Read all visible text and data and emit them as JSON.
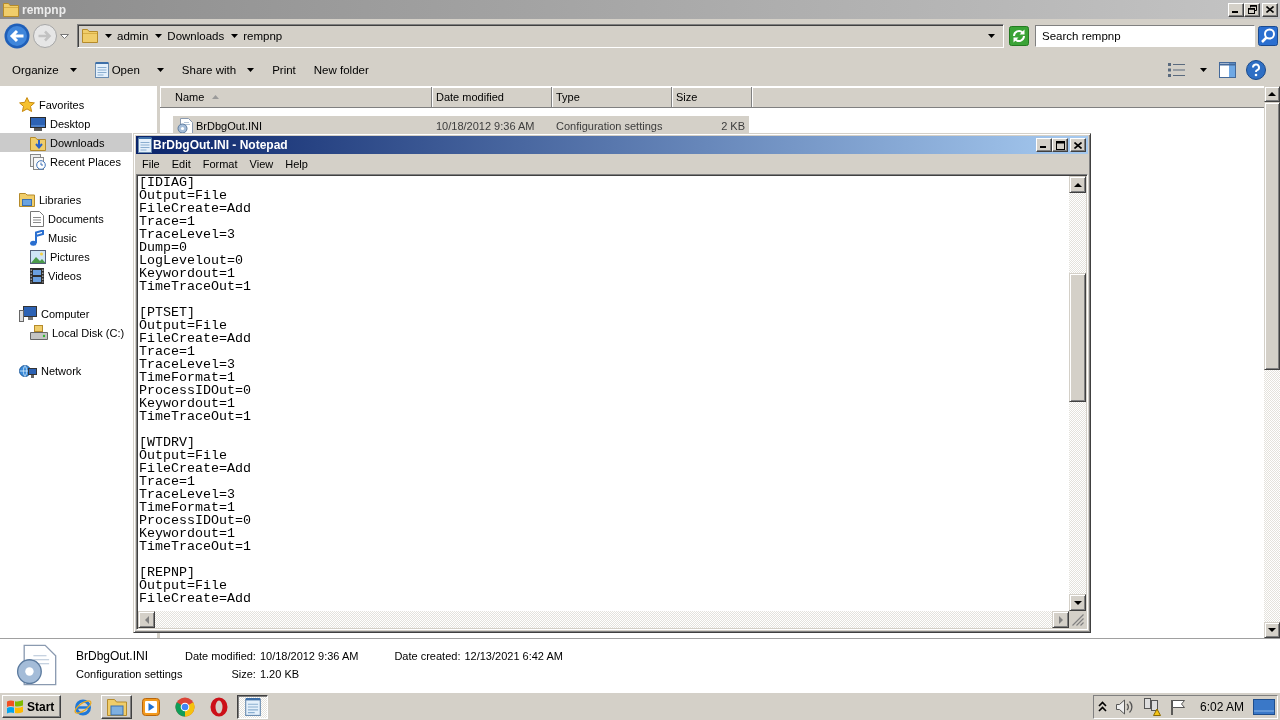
{
  "explorer": {
    "title": "rempnp",
    "active": false,
    "maximized": true,
    "breadcrumb": [
      "admin",
      "Downloads",
      "rempnp"
    ],
    "search": {
      "placeholder": "Search rempnp"
    },
    "toolbar": [
      {
        "label": "Organize",
        "kind": "menu"
      },
      {
        "label": "Open",
        "kind": "split"
      },
      {
        "label": "Share with",
        "kind": "menu"
      },
      {
        "label": "Print",
        "kind": "command"
      },
      {
        "label": "New folder",
        "kind": "command"
      }
    ],
    "sidebar": [
      {
        "label": "Favorites",
        "selected": false,
        "children": [
          {
            "label": "Desktop",
            "selected": false
          },
          {
            "label": "Downloads",
            "selected": true
          },
          {
            "label": "Recent Places",
            "selected": false
          }
        ]
      },
      {
        "label": "Libraries",
        "selected": false,
        "children": [
          {
            "label": "Documents",
            "selected": false
          },
          {
            "label": "Music",
            "selected": false
          },
          {
            "label": "Pictures",
            "selected": false
          },
          {
            "label": "Videos",
            "selected": false
          }
        ]
      },
      {
        "label": "Computer",
        "selected": false,
        "children": [
          {
            "label": "Local Disk (C:)",
            "selected": false
          }
        ]
      },
      {
        "label": "Network",
        "selected": false
      }
    ],
    "columns": [
      {
        "label": "Name",
        "sorted": true
      },
      {
        "label": "Date modified",
        "sorted": false
      },
      {
        "label": "Type",
        "sorted": false
      },
      {
        "label": "Size",
        "sorted": false
      }
    ],
    "rows": [
      {
        "name": "BrDbgOut.INI",
        "date_modified": "10/18/2012 9:36 AM",
        "type": "Configuration settings",
        "size": "2 KB",
        "selected": true
      }
    ],
    "details": {
      "name": "BrDbgOut.INI",
      "type": "Configuration settings",
      "columns": [
        [
          {
            "label": "Date modified:",
            "value": "10/18/2012 9:36 AM"
          },
          {
            "label": "Size:",
            "value": "1.20 KB"
          }
        ],
        [
          {
            "label": "Date created:",
            "value": "12/13/2021 6:42 AM"
          }
        ]
      ]
    }
  },
  "notepad": {
    "title": "BrDbgOut.INI - Notepad",
    "active": true,
    "maximized": false,
    "menu": [
      "File",
      "Edit",
      "Format",
      "View",
      "Help"
    ],
    "text": "[IDIAG]\nOutput=File\nFileCreate=Add\nTrace=1\nTraceLevel=3\nDump=0\nLogLevelout=0\nKeywordout=1\nTimeTraceOut=1\n\n[PTSET]\nOutput=File\nFileCreate=Add\nTrace=1\nTraceLevel=3\nTimeFormat=1\nProcessIDOut=0\nKeywordout=1\nTimeTraceOut=1\n\n[WTDRV]\nOutput=File\nFileCreate=Add\nTrace=1\nTraceLevel=3\nTimeFormat=1\nProcessIDOut=0\nKeywordout=1\nTimeTraceOut=1\n\n[REPNP]\nOutput=File\nFileCreate=Add"
  },
  "taskbar": {
    "start": "Start",
    "apps": [
      {
        "open": false,
        "selected": false
      },
      {
        "open": true,
        "selected": false
      },
      {
        "open": false,
        "selected": false
      },
      {
        "open": false,
        "selected": false
      },
      {
        "open": false,
        "selected": false
      },
      {
        "open": true,
        "selected": true
      }
    ],
    "clock": "6:02 AM"
  }
}
